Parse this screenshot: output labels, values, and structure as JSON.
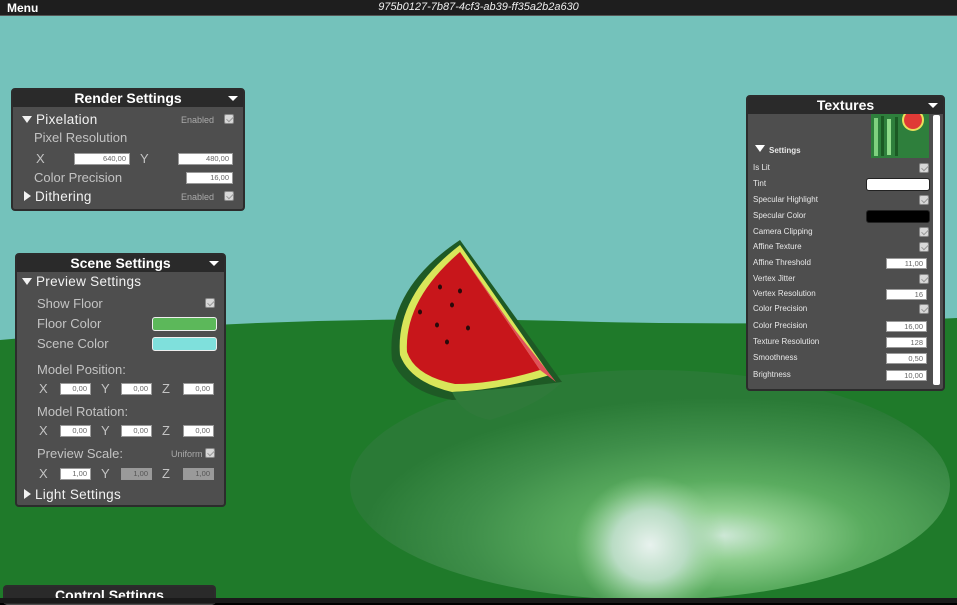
{
  "topbar": {
    "menu": "Menu",
    "title": "975b0127-7b87-4cf3-ab39-ff35a2b2a630"
  },
  "render_settings": {
    "title": "Render Settings",
    "pixelation": {
      "label": "Pixelation",
      "enabled_label": "Enabled"
    },
    "pixel_resolution": {
      "label": "Pixel Resolution",
      "x_label": "X",
      "x": "640,00",
      "y_label": "Y",
      "y": "480,00"
    },
    "color_precision": {
      "label": "Color Precision",
      "value": "16,00"
    },
    "dithering": {
      "label": "Dithering",
      "enabled_label": "Enabled"
    }
  },
  "scene_settings": {
    "title": "Scene Settings",
    "preview_settings": "Preview Settings",
    "show_floor": "Show Floor",
    "floor_color": {
      "label": "Floor Color",
      "color": "#5cb85a"
    },
    "scene_color": {
      "label": "Scene Color",
      "color": "#7fe0dc"
    },
    "model_position": {
      "label": "Model Position:",
      "x": "0,00",
      "y": "0,00",
      "z": "0,00"
    },
    "model_rotation": {
      "label": "Model Rotation:",
      "x": "0,00",
      "y": "0,00",
      "z": "0,00"
    },
    "preview_scale": {
      "label": "Preview Scale:",
      "uniform_label": "Uniform",
      "x": "1,00",
      "y": "1,00",
      "z": "1,00"
    },
    "axis": {
      "x": "X",
      "y": "Y",
      "z": "Z"
    },
    "light_settings": "Light Settings"
  },
  "control_settings": {
    "title": "Control Settings"
  },
  "textures": {
    "title": "Textures",
    "settings": "Settings",
    "is_lit": "Is Lit",
    "tint": {
      "label": "Tint",
      "color": "#ffffff"
    },
    "specular_highlight": "Specular Highlight",
    "specular_color": {
      "label": "Specular Color",
      "color": "#000000"
    },
    "camera_clipping": "Camera Clipping",
    "affine_texture": "Affine Texture",
    "affine_threshold": {
      "label": "Affine Threshold",
      "value": "11,00"
    },
    "vertex_jitter": "Vertex Jitter",
    "vertex_resolution": {
      "label": "Vertex Resolution",
      "value": "16"
    },
    "color_precision_toggle": "Color Precision",
    "color_precision": {
      "label": "Color Precision",
      "value": "16,00"
    },
    "texture_resolution": {
      "label": "Texture Resolution",
      "value": "128"
    },
    "smoothness": {
      "label": "Smoothness",
      "value": "0,50"
    },
    "brightness": {
      "label": "Brightness",
      "value": "10,00"
    }
  },
  "scene": {
    "sky_color": "#74c2bb",
    "floor_color": "#1f7a2a",
    "model": "watermelon-slice"
  }
}
